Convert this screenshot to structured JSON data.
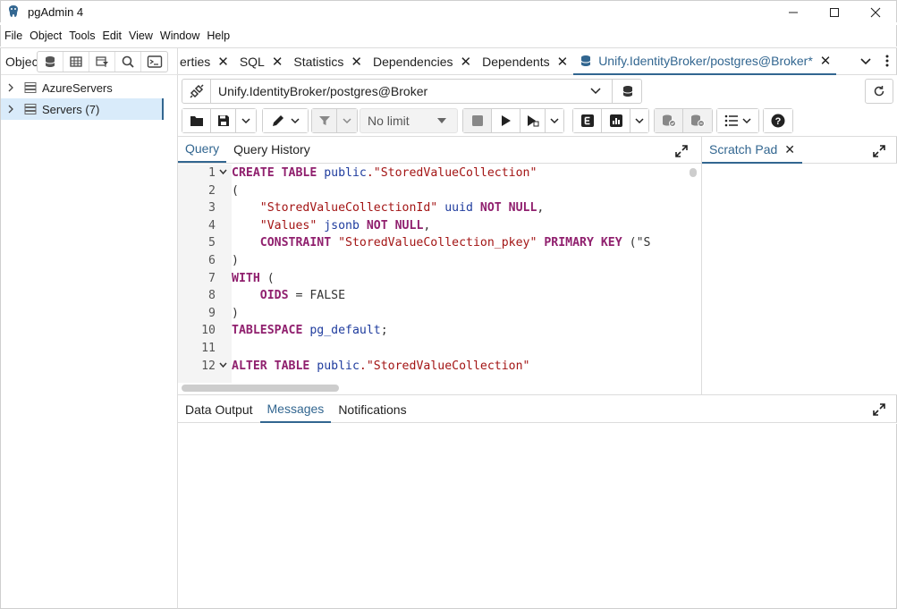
{
  "window": {
    "title": "pgAdmin 4"
  },
  "menu": [
    "File",
    "Object",
    "Tools",
    "Edit",
    "View",
    "Window",
    "Help"
  ],
  "object_explorer": {
    "label": "Object",
    "tree": [
      {
        "label": "AzureServers",
        "selected": false
      },
      {
        "label": "Servers (7)",
        "selected": true
      }
    ]
  },
  "main_tabs": [
    {
      "label": "erties",
      "active": false
    },
    {
      "label": "SQL",
      "active": false
    },
    {
      "label": "Statistics",
      "active": false
    },
    {
      "label": "Dependencies",
      "active": false
    },
    {
      "label": "Dependents",
      "active": false
    },
    {
      "label": "Unify.IdentityBroker/postgres@Broker*",
      "active": true
    }
  ],
  "connection": {
    "value": "Unify.IdentityBroker/postgres@Broker"
  },
  "toolbar": {
    "limit_value": "No limit"
  },
  "query_tabs": [
    "Query",
    "Query History"
  ],
  "scratch_pad": {
    "label": "Scratch Pad"
  },
  "editor_lines": [
    {
      "n": "1",
      "fold": true
    },
    {
      "n": "2",
      "fold": false
    },
    {
      "n": "3",
      "fold": false
    },
    {
      "n": "4",
      "fold": false
    },
    {
      "n": "5",
      "fold": false
    },
    {
      "n": "6",
      "fold": false
    },
    {
      "n": "7",
      "fold": false
    },
    {
      "n": "8",
      "fold": false
    },
    {
      "n": "9",
      "fold": false
    },
    {
      "n": "10",
      "fold": false
    },
    {
      "n": "11",
      "fold": false
    },
    {
      "n": "12",
      "fold": true
    }
  ],
  "code": {
    "l1": {
      "k1": "CREATE TABLE",
      "id": " public",
      "s": ".\"StoredValueCollection\""
    },
    "l2": "(",
    "l3": {
      "s": "    \"StoredValueCollectionId\"",
      "id": " uuid",
      "k": " NOT NULL",
      "p": ","
    },
    "l4": {
      "s": "    \"Values\"",
      "id": " jsonb",
      "k": " NOT NULL",
      "p": ","
    },
    "l5": {
      "k1": "    CONSTRAINT",
      "s": " \"StoredValueCollection_pkey\"",
      "k2": " PRIMARY KEY",
      "p": " (\"S"
    },
    "l6": ")",
    "l7": {
      "k": "WITH",
      "p": " ("
    },
    "l8": {
      "k": "    OIDS",
      "p": " = FALSE"
    },
    "l9": ")",
    "l10": {
      "k": "TABLESPACE",
      "id": " pg_default",
      "p": ";"
    },
    "l11": "",
    "l12": {
      "k": "ALTER TABLE",
      "id": " public",
      "s": ".\"StoredValueCollection\""
    }
  },
  "output_tabs": [
    "Data Output",
    "Messages",
    "Notifications"
  ],
  "output_active": "Messages",
  "colors": {
    "accent": "#326690",
    "keyword": "#90206e",
    "string": "#a31515",
    "identifier": "#1f3c9e",
    "selected_bg": "#d9ebfa"
  }
}
